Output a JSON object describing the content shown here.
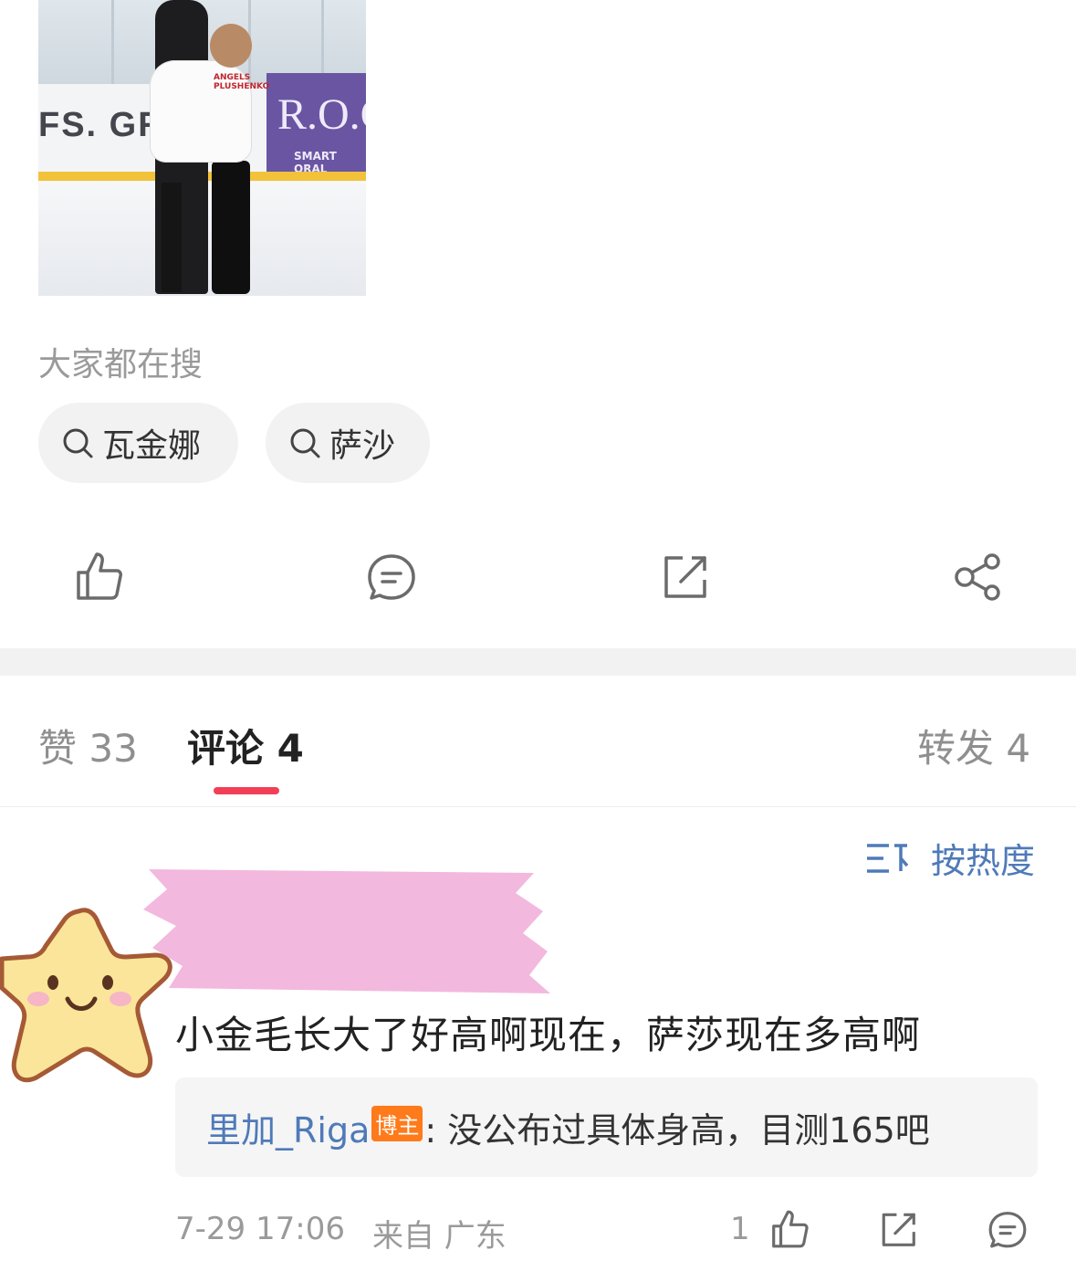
{
  "post": {
    "image_alt": "Photo of two figure skaters hugging on an ice rink"
  },
  "trending": {
    "title": "大家都在搜",
    "chips": [
      {
        "label": "瓦金娜",
        "icon": "search-icon"
      },
      {
        "label": "萨沙",
        "icon": "search-icon"
      }
    ]
  },
  "actions": [
    {
      "name": "like",
      "icon": "thumbs-up-icon"
    },
    {
      "name": "comment",
      "icon": "comment-icon"
    },
    {
      "name": "repost",
      "icon": "repost-icon"
    },
    {
      "name": "share",
      "icon": "share-icon"
    }
  ],
  "tabs": [
    {
      "label": "赞 33",
      "active": false
    },
    {
      "label": "评论 4",
      "active": true
    },
    {
      "label": "转发 4",
      "active": false
    }
  ],
  "sort": {
    "label": "按热度",
    "icon": "sort-icon"
  },
  "comment": {
    "text": "小金毛长大了好高啊现在，萨莎现在多高啊",
    "reply": {
      "author": "里加_Riga",
      "badge": "博主",
      "body": ": 没公布过具体身高，目测165吧"
    },
    "timestamp": "7-29 17:06",
    "location": "来自 广东",
    "likes": "1"
  },
  "colors": {
    "accent_underline": "#f33e57",
    "link_blue": "#4f7ab8",
    "badge_orange": "#ff7a1a",
    "chip_bg": "#f2f2f2"
  }
}
